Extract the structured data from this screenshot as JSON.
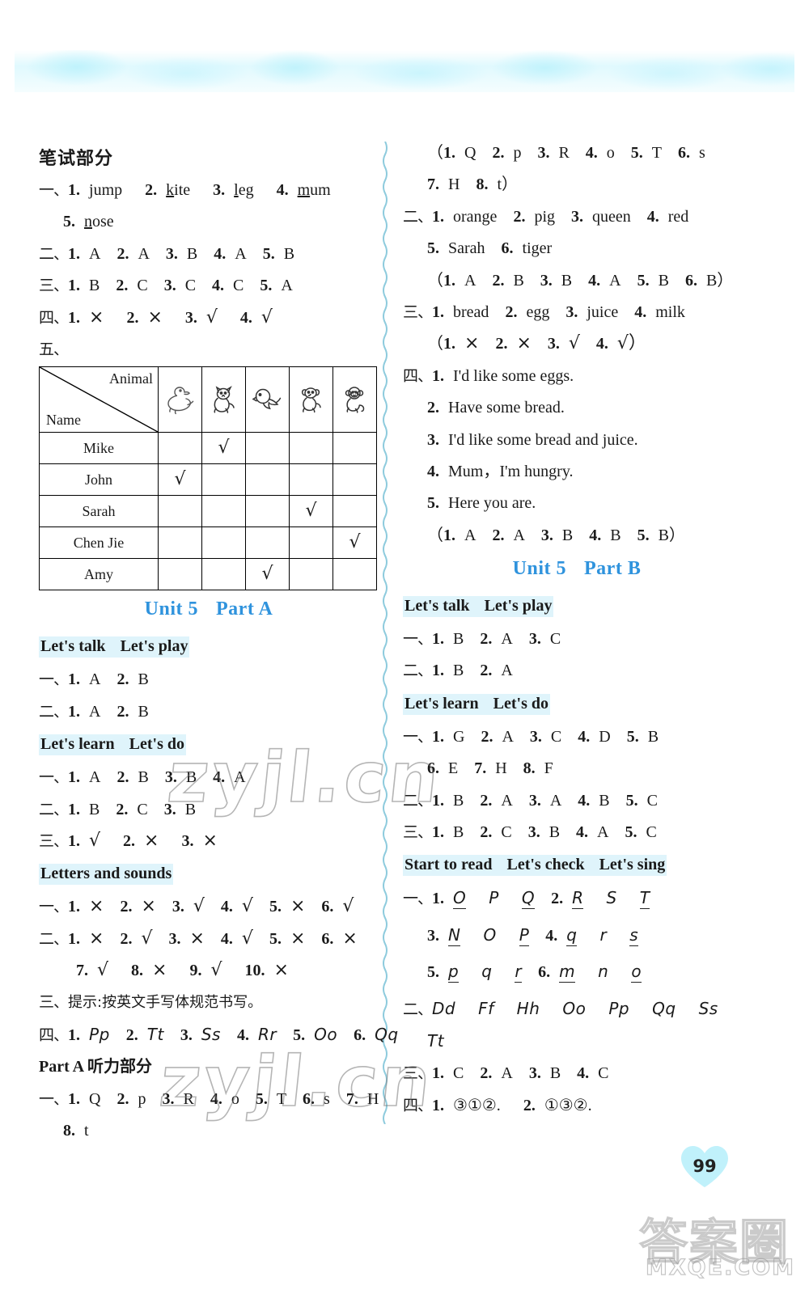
{
  "page": {
    "number": "99",
    "watermarks": [
      "zyjl.cn",
      "zyjl.cn",
      "答案圈",
      "MXQE.COM"
    ]
  },
  "left_column": {
    "title": "笔试部分",
    "blocks": [
      {
        "type": "answer-line",
        "label": "一、",
        "items": [
          {
            "n": "1.",
            "a": "jump",
            "u": "j"
          },
          {
            "n": "2.",
            "a": "kite",
            "u": "k"
          },
          {
            "n": "3.",
            "a": "leg",
            "u": "l"
          },
          {
            "n": "4.",
            "a": "mum",
            "u": "m"
          }
        ],
        "cont": [
          {
            "n": "5.",
            "a": "nose",
            "u": "n"
          }
        ]
      },
      {
        "type": "answer-line",
        "label": "二、",
        "items": [
          {
            "n": "1.",
            "a": "A"
          },
          {
            "n": "2.",
            "a": "A"
          },
          {
            "n": "3.",
            "a": "B"
          },
          {
            "n": "4.",
            "a": "A"
          },
          {
            "n": "5.",
            "a": "B"
          }
        ]
      },
      {
        "type": "answer-line",
        "label": "三、",
        "items": [
          {
            "n": "1.",
            "a": "B"
          },
          {
            "n": "2.",
            "a": "C"
          },
          {
            "n": "3.",
            "a": "C"
          },
          {
            "n": "4.",
            "a": "C"
          },
          {
            "n": "5.",
            "a": "A"
          }
        ]
      },
      {
        "type": "answer-line",
        "label": "四、",
        "items": [
          {
            "n": "1.",
            "a": "×"
          },
          {
            "n": "2.",
            "a": "×"
          },
          {
            "n": "3.",
            "a": "√"
          },
          {
            "n": "4.",
            "a": "√"
          }
        ]
      },
      {
        "type": "label-only",
        "label": "五、"
      }
    ],
    "table": {
      "corner_top": "Animal",
      "corner_bottom": "Name",
      "animals": [
        "duck",
        "cat",
        "bird",
        "dog",
        "monkey"
      ],
      "rows": [
        {
          "name": "Mike",
          "checked": 1
        },
        {
          "name": "John",
          "checked": 0
        },
        {
          "name": "Sarah",
          "checked": 3
        },
        {
          "name": "Chen Jie",
          "checked": 4
        },
        {
          "name": "Amy",
          "checked": 2
        }
      ],
      "check_mark": "√"
    },
    "unit_heading": {
      "unit": "Unit 5",
      "part": "Part A"
    },
    "sections": [
      {
        "heading_a": "Let's talk",
        "heading_b": "Let's play",
        "lines": [
          {
            "label": "一、",
            "items": [
              {
                "n": "1.",
                "a": "A"
              },
              {
                "n": "2.",
                "a": "B"
              }
            ]
          },
          {
            "label": "二、",
            "items": [
              {
                "n": "1.",
                "a": "A"
              },
              {
                "n": "2.",
                "a": "B"
              }
            ]
          }
        ]
      },
      {
        "heading_a": "Let's learn",
        "heading_b": "Let's do",
        "lines": [
          {
            "label": "一、",
            "items": [
              {
                "n": "1.",
                "a": "A"
              },
              {
                "n": "2.",
                "a": "B"
              },
              {
                "n": "3.",
                "a": "B"
              },
              {
                "n": "4.",
                "a": "A"
              }
            ]
          },
          {
            "label": "二、",
            "items": [
              {
                "n": "1.",
                "a": "B"
              },
              {
                "n": "2.",
                "a": "C"
              },
              {
                "n": "3.",
                "a": "B"
              }
            ]
          },
          {
            "label": "三、",
            "items": [
              {
                "n": "1.",
                "a": "√"
              },
              {
                "n": "2.",
                "a": "×"
              },
              {
                "n": "3.",
                "a": "×"
              }
            ]
          }
        ]
      },
      {
        "heading_a": "Letters and sounds",
        "heading_b": "",
        "lines": [
          {
            "label": "一、",
            "items": [
              {
                "n": "1.",
                "a": "×"
              },
              {
                "n": "2.",
                "a": "×"
              },
              {
                "n": "3.",
                "a": "√"
              },
              {
                "n": "4.",
                "a": "√"
              },
              {
                "n": "5.",
                "a": "×"
              },
              {
                "n": "6.",
                "a": "√"
              }
            ]
          },
          {
            "label": "二、",
            "items": [
              {
                "n": "1.",
                "a": "×"
              },
              {
                "n": "2.",
                "a": "√"
              },
              {
                "n": "3.",
                "a": "×"
              },
              {
                "n": "4.",
                "a": "√"
              },
              {
                "n": "5.",
                "a": "×"
              },
              {
                "n": "6.",
                "a": "×"
              }
            ],
            "cont": [
              {
                "n": "7.",
                "a": "√"
              },
              {
                "n": "8.",
                "a": "×"
              },
              {
                "n": "9.",
                "a": "√"
              },
              {
                "n": "10.",
                "a": "×"
              }
            ]
          }
        ],
        "tip": {
          "label": "三、",
          "text": "提示:按英文手写体规范书写。"
        },
        "hand_line": {
          "label": "四、",
          "items": [
            {
              "n": "1.",
              "a": "Pp"
            },
            {
              "n": "2.",
              "a": "Tt"
            },
            {
              "n": "3.",
              "a": "Ss"
            },
            {
              "n": "4.",
              "a": "Rr"
            },
            {
              "n": "5.",
              "a": "Oo"
            },
            {
              "n": "6.",
              "a": "Qq"
            }
          ]
        }
      }
    ],
    "listening": {
      "heading": "Part A 听力部分",
      "lines": [
        {
          "label": "一、",
          "items": [
            {
              "n": "1.",
              "a": "Q"
            },
            {
              "n": "2.",
              "a": "p"
            },
            {
              "n": "3.",
              "a": "R"
            },
            {
              "n": "4.",
              "a": "o"
            },
            {
              "n": "5.",
              "a": "T"
            },
            {
              "n": "6.",
              "a": "s"
            },
            {
              "n": "7.",
              "a": "H"
            }
          ],
          "cont": [
            {
              "n": "8.",
              "a": "t"
            }
          ]
        }
      ]
    }
  },
  "right_column": {
    "blocks": [
      {
        "type": "paren-line",
        "open": "（",
        "items": [
          {
            "n": "1.",
            "a": "Q"
          },
          {
            "n": "2.",
            "a": "p"
          },
          {
            "n": "3.",
            "a": "R"
          },
          {
            "n": "4.",
            "a": "o"
          },
          {
            "n": "5.",
            "a": "T"
          },
          {
            "n": "6.",
            "a": "s"
          }
        ],
        "cont": [
          {
            "n": "7.",
            "a": "H"
          },
          {
            "n": "8.",
            "a": "t）"
          }
        ]
      },
      {
        "type": "answer-line",
        "label": "二、",
        "items": [
          {
            "n": "1.",
            "a": "orange"
          },
          {
            "n": "2.",
            "a": "pig"
          },
          {
            "n": "3.",
            "a": "queen"
          },
          {
            "n": "4.",
            "a": "red"
          }
        ],
        "cont": [
          {
            "n": "5.",
            "a": "Sarah"
          },
          {
            "n": "6.",
            "a": "tiger"
          }
        ]
      },
      {
        "type": "paren-line",
        "open": "（",
        "items": [
          {
            "n": "1.",
            "a": "A"
          },
          {
            "n": "2.",
            "a": "B"
          },
          {
            "n": "3.",
            "a": "B"
          },
          {
            "n": "4.",
            "a": "A"
          },
          {
            "n": "5.",
            "a": "B"
          },
          {
            "n": "6.",
            "a": "B）"
          }
        ]
      },
      {
        "type": "answer-line",
        "label": "三、",
        "items": [
          {
            "n": "1.",
            "a": "bread"
          },
          {
            "n": "2.",
            "a": "egg"
          },
          {
            "n": "3.",
            "a": "juice"
          },
          {
            "n": "4.",
            "a": "milk"
          }
        ]
      },
      {
        "type": "paren-line",
        "open": "（",
        "items": [
          {
            "n": "1.",
            "a": "×"
          },
          {
            "n": "2.",
            "a": "×"
          },
          {
            "n": "3.",
            "a": "√"
          },
          {
            "n": "4.",
            "a": "√）"
          }
        ]
      },
      {
        "type": "sentence-block",
        "label": "四、",
        "sentences": [
          {
            "n": "1.",
            "a": "I'd like some eggs."
          },
          {
            "n": "2.",
            "a": "Have some bread."
          },
          {
            "n": "3.",
            "a": "I'd like some bread and juice."
          },
          {
            "n": "4.",
            "a": "Mum，I'm hungry."
          },
          {
            "n": "5.",
            "a": "Here you are."
          }
        ]
      },
      {
        "type": "paren-line",
        "open": "（",
        "items": [
          {
            "n": "1.",
            "a": "A"
          },
          {
            "n": "2.",
            "a": "A"
          },
          {
            "n": "3.",
            "a": "B"
          },
          {
            "n": "4.",
            "a": "B"
          },
          {
            "n": "5.",
            "a": "B）"
          }
        ]
      }
    ],
    "unit_heading": {
      "unit": "Unit 5",
      "part": "Part B"
    },
    "sections": [
      {
        "heading_a": "Let's talk",
        "heading_b": "Let's play",
        "lines": [
          {
            "label": "一、",
            "items": [
              {
                "n": "1.",
                "a": "B"
              },
              {
                "n": "2.",
                "a": "A"
              },
              {
                "n": "3.",
                "a": "C"
              }
            ]
          },
          {
            "label": "二、",
            "items": [
              {
                "n": "1.",
                "a": "B"
              },
              {
                "n": "2.",
                "a": "A"
              }
            ]
          }
        ]
      },
      {
        "heading_a": "Let's learn",
        "heading_b": "Let's do",
        "lines": [
          {
            "label": "一、",
            "items": [
              {
                "n": "1.",
                "a": "G"
              },
              {
                "n": "2.",
                "a": "A"
              },
              {
                "n": "3.",
                "a": "C"
              },
              {
                "n": "4.",
                "a": "D"
              },
              {
                "n": "5.",
                "a": "B"
              }
            ],
            "cont": [
              {
                "n": "6.",
                "a": "E"
              },
              {
                "n": "7.",
                "a": "H"
              },
              {
                "n": "8.",
                "a": "F"
              }
            ]
          },
          {
            "label": "二、",
            "items": [
              {
                "n": "1.",
                "a": "B"
              },
              {
                "n": "2.",
                "a": "A"
              },
              {
                "n": "3.",
                "a": "A"
              },
              {
                "n": "4.",
                "a": "B"
              },
              {
                "n": "5.",
                "a": "C"
              }
            ]
          },
          {
            "label": "三、",
            "items": [
              {
                "n": "1.",
                "a": "B"
              },
              {
                "n": "2.",
                "a": "C"
              },
              {
                "n": "3.",
                "a": "B"
              },
              {
                "n": "4.",
                "a": "A"
              },
              {
                "n": "5.",
                "a": "C"
              }
            ]
          }
        ]
      }
    ],
    "read_section": {
      "heading_a": "Start to read",
      "heading_b": "Let's check",
      "heading_c": "Let's sing",
      "letter_lines": [
        {
          "label": "一、",
          "groups": [
            {
              "n": "1.",
              "letters": [
                {
                  "t": "O",
                  "u": true
                },
                {
                  "t": "P",
                  "u": false
                },
                {
                  "t": "Q",
                  "u": true
                }
              ]
            },
            {
              "n": "2.",
              "letters": [
                {
                  "t": "R",
                  "u": true
                },
                {
                  "t": "S",
                  "u": false
                },
                {
                  "t": "T",
                  "u": true
                }
              ]
            }
          ]
        },
        {
          "label": "",
          "groups": [
            {
              "n": "3.",
              "letters": [
                {
                  "t": "N",
                  "u": true
                },
                {
                  "t": "O",
                  "u": false
                },
                {
                  "t": "P",
                  "u": true
                }
              ]
            },
            {
              "n": "4.",
              "letters": [
                {
                  "t": "q",
                  "u": true
                },
                {
                  "t": "r",
                  "u": false
                },
                {
                  "t": "s",
                  "u": true
                }
              ]
            }
          ]
        },
        {
          "label": "",
          "groups": [
            {
              "n": "5.",
              "letters": [
                {
                  "t": "p",
                  "u": true
                },
                {
                  "t": "q",
                  "u": false
                },
                {
                  "t": "r",
                  "u": true
                }
              ]
            },
            {
              "n": "6.",
              "letters": [
                {
                  "t": "m",
                  "u": true
                },
                {
                  "t": "n",
                  "u": false
                },
                {
                  "t": "o",
                  "u": true
                }
              ]
            }
          ]
        }
      ],
      "pairs_line": {
        "label": "二、",
        "pairs": [
          "Dd",
          "Ff",
          "Hh",
          "Oo",
          "Pp",
          "Qq",
          "Ss"
        ],
        "cont": [
          "Tt"
        ]
      },
      "lines": [
        {
          "label": "三、",
          "items": [
            {
              "n": "1.",
              "a": "C"
            },
            {
              "n": "2.",
              "a": "A"
            },
            {
              "n": "3.",
              "a": "B"
            },
            {
              "n": "4.",
              "a": "C"
            }
          ]
        },
        {
          "label": "四、",
          "items": [
            {
              "n": "1.",
              "a": "③①②."
            },
            {
              "n": "2.",
              "a": "①③②."
            }
          ]
        }
      ]
    }
  }
}
